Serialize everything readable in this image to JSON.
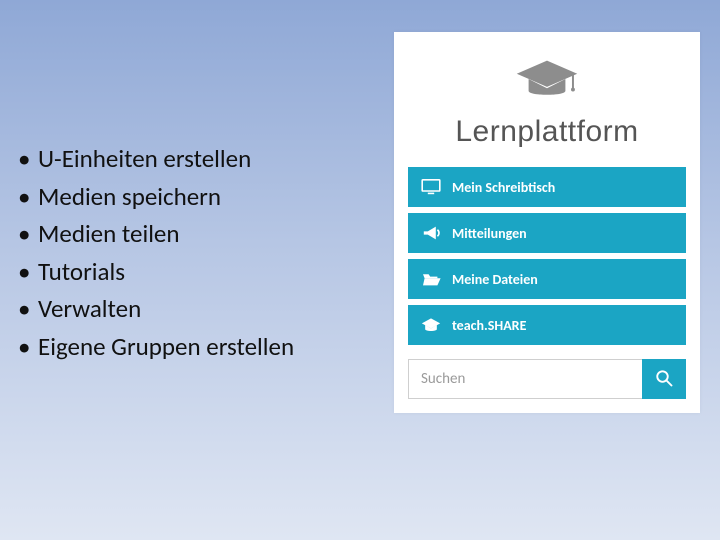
{
  "bullets": [
    "U-Einheiten erstellen",
    "Medien speichern",
    "Medien teilen",
    "Tutorials",
    "Verwalten",
    "Eigene Gruppen erstellen"
  ],
  "panel": {
    "title": "Lernplattform",
    "menu": [
      {
        "label": "Mein Schreibtisch",
        "icon": "desktop-icon"
      },
      {
        "label": "Mitteilungen",
        "icon": "bullhorn-icon"
      },
      {
        "label": "Meine Dateien",
        "icon": "folder-open-icon"
      },
      {
        "label": "teach.SHARE",
        "icon": "graduation-cap-icon"
      }
    ],
    "search_placeholder": "Suchen"
  },
  "colors": {
    "accent": "#1ba5c4",
    "grey": "#8d8d8d"
  }
}
